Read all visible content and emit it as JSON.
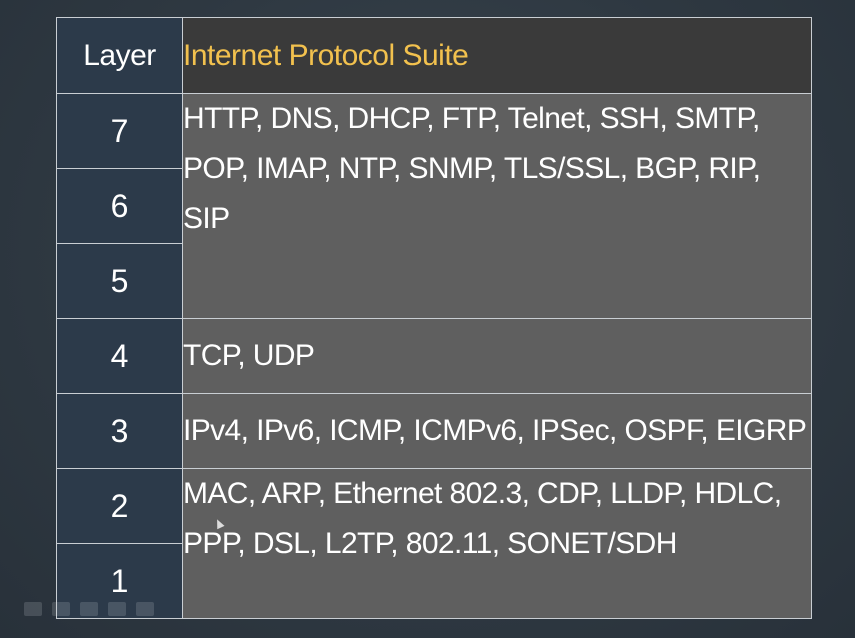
{
  "table": {
    "header": {
      "layer": "Layer",
      "suite": "Internet Protocol Suite"
    },
    "groups": [
      {
        "layers": [
          "7",
          "6",
          "5"
        ],
        "protocols": "HTTP, DNS, DHCP, FTP, Telnet, SSH, SMTP, POP, IMAP, NTP, SNMP, TLS/SSL, BGP, RIP, SIP"
      },
      {
        "layers": [
          "4"
        ],
        "protocols": "TCP, UDP"
      },
      {
        "layers": [
          "3"
        ],
        "protocols": "IPv4, IPv6, ICMP, ICMPv6, IPSec, OSPF, EIGRP"
      },
      {
        "layers": [
          "2",
          "1"
        ],
        "protocols": "MAC, ARP, Ethernet 802.3, CDP, LLDP, HDLC, PPP, DSL, L2TP, 802.11, SONET/SDH"
      }
    ]
  },
  "colors": {
    "background": "#2f3942",
    "layer_cell": "#2c3a4a",
    "protocol_cell": "#5f5f5f",
    "header_accent": "#f2c14e"
  }
}
